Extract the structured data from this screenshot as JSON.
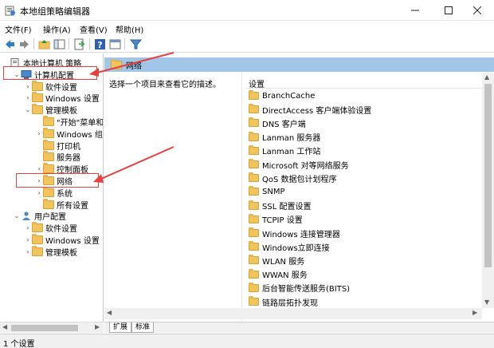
{
  "window": {
    "title": "本地组策略编辑器"
  },
  "menu": [
    "文件(F)",
    "操作(A)",
    "查看(V)",
    "帮助(H)"
  ],
  "tree": [
    {
      "label": "本地计算机 策略",
      "indent": 0,
      "twisty": "",
      "icon": "policy"
    },
    {
      "label": "计算机配置",
      "indent": 1,
      "twisty": "v",
      "icon": "computer"
    },
    {
      "label": "软件设置",
      "indent": 2,
      "twisty": ">",
      "icon": "folder"
    },
    {
      "label": "Windows 设置",
      "indent": 2,
      "twisty": ">",
      "icon": "folder"
    },
    {
      "label": "管理模板",
      "indent": 2,
      "twisty": "v",
      "icon": "folder"
    },
    {
      "label": "\"开始\"菜单和任",
      "indent": 3,
      "twisty": "",
      "icon": "folder"
    },
    {
      "label": "Windows 组件",
      "indent": 3,
      "twisty": ">",
      "icon": "folder"
    },
    {
      "label": "打印机",
      "indent": 3,
      "twisty": "",
      "icon": "folder"
    },
    {
      "label": "服务器",
      "indent": 3,
      "twisty": "",
      "icon": "folder"
    },
    {
      "label": "控制面板",
      "indent": 3,
      "twisty": ">",
      "icon": "folder"
    },
    {
      "label": "网络",
      "indent": 3,
      "twisty": ">",
      "icon": "folder"
    },
    {
      "label": "系统",
      "indent": 3,
      "twisty": ">",
      "icon": "folder"
    },
    {
      "label": "所有设置",
      "indent": 3,
      "twisty": "",
      "icon": "folder"
    },
    {
      "label": "用户配置",
      "indent": 1,
      "twisty": "v",
      "icon": "user"
    },
    {
      "label": "软件设置",
      "indent": 2,
      "twisty": ">",
      "icon": "folder"
    },
    {
      "label": "Windows 设置",
      "indent": 2,
      "twisty": ">",
      "icon": "folder"
    },
    {
      "label": "管理模板",
      "indent": 2,
      "twisty": ">",
      "icon": "folder"
    }
  ],
  "right_pane": {
    "header": "网络",
    "description": "选择一个项目来查看它的描述。",
    "column_header": "设置",
    "items": [
      "BranchCache",
      "DirectAccess 客户端体验设置",
      "DNS 客户端",
      "Lanman 服务器",
      "Lanman 工作站",
      "Microsoft 对等网络服务",
      "QoS 数据包计划程序",
      "SNMP",
      "SSL 配置设置",
      "TCPIP 设置",
      "Windows 连接管理器",
      "Windows立即连接",
      "WLAN 服务",
      "WWAN 服务",
      "后台智能传送服务(BITS)",
      "链路层拓扑发现"
    ]
  },
  "tabs": [
    "扩展",
    "标准"
  ],
  "status": "1 个设置",
  "colors": {
    "header_bg": "#a2c6e8",
    "annotation": "#e8403e",
    "folder": "#f2c55c"
  }
}
